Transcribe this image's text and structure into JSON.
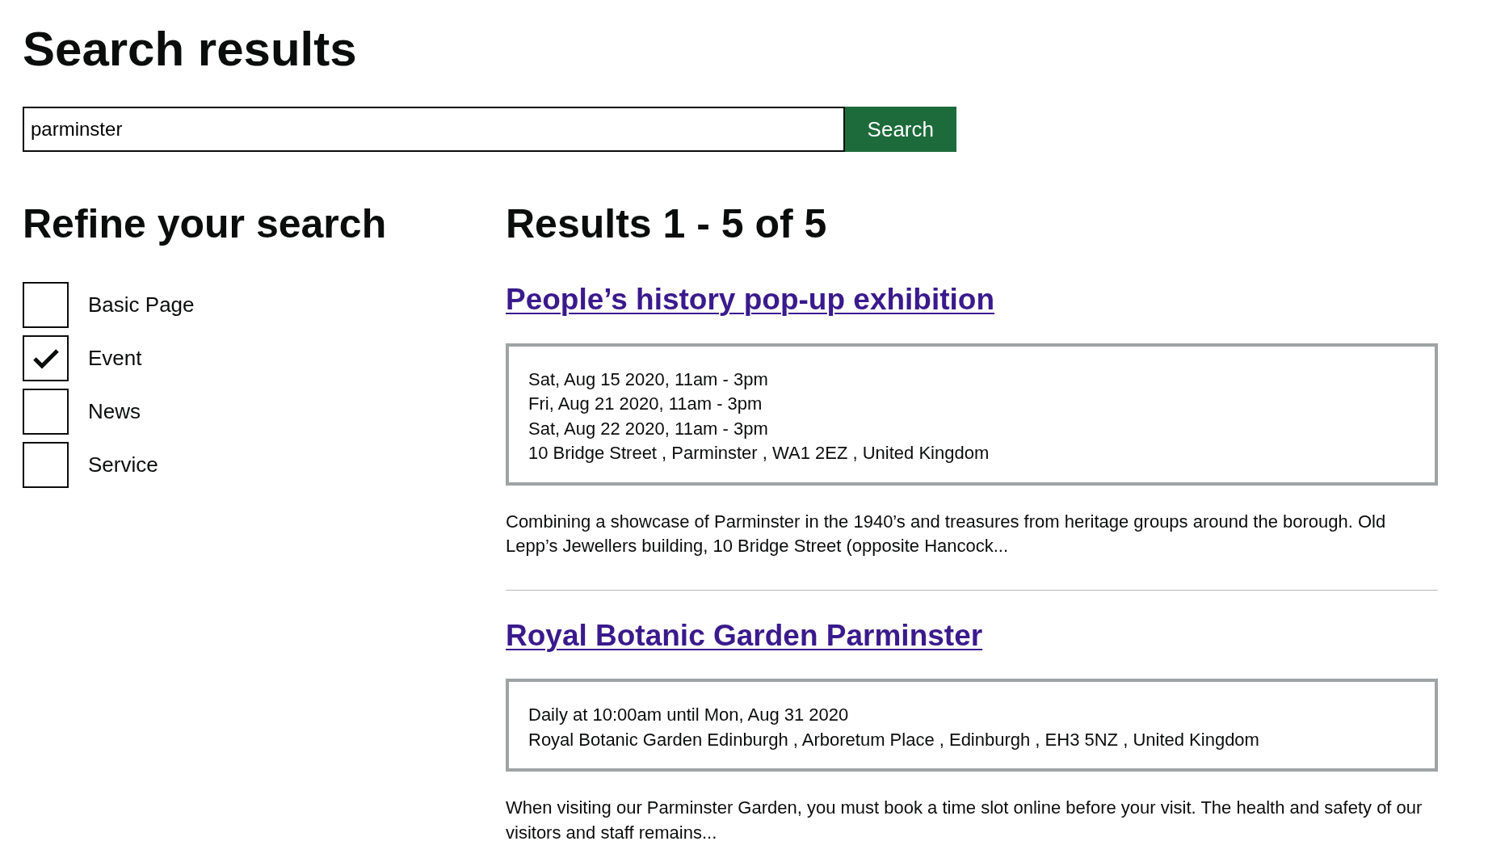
{
  "page": {
    "title": "Search results"
  },
  "search": {
    "value": "parminster",
    "button": "Search"
  },
  "refine": {
    "heading": "Refine your search",
    "filters": [
      {
        "label": "Basic Page",
        "checked": false
      },
      {
        "label": "Event",
        "checked": true
      },
      {
        "label": "News",
        "checked": false
      },
      {
        "label": "Service",
        "checked": false
      }
    ]
  },
  "results": {
    "heading": "Results 1 - 5 of 5",
    "items": [
      {
        "title": "People’s history pop-up exhibition",
        "details": [
          "Sat, Aug 15 2020, 11am - 3pm",
          "Fri, Aug 21 2020, 11am - 3pm",
          "Sat, Aug 22 2020, 11am - 3pm",
          "10 Bridge Street , Parminster , WA1 2EZ , United Kingdom"
        ],
        "summary": "Combining a showcase of Parminster in the 1940’s and treasures from heritage groups around the borough. Old Lepp’s Jewellers building, 10 Bridge Street (opposite Hancock..."
      },
      {
        "title": "Royal Botanic Garden Parminster",
        "details": [
          "Daily at 10:00am until Mon, Aug 31 2020",
          "Royal Botanic Garden Edinburgh , Arboretum Place , Edinburgh , EH3 5NZ , United Kingdom"
        ],
        "summary": "When visiting our Parminster Garden, you must book a time slot online before your visit. The health and safety of our visitors and staff remains..."
      }
    ]
  }
}
